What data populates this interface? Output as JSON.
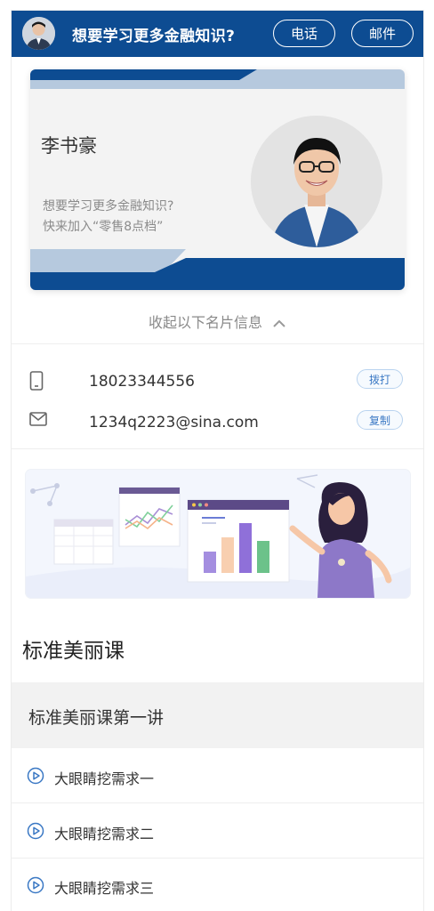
{
  "header": {
    "title": "想要学习更多金融知识?",
    "phone_label": "电话",
    "mail_label": "邮件"
  },
  "card": {
    "name": "李书豪",
    "line1": "想要学习更多金融知识?",
    "line2": "快来加入“零售8点档”"
  },
  "collapse": {
    "label": "收起以下名片信息"
  },
  "contact": {
    "phone": "18023344556",
    "phone_action": "拨打",
    "email": "1234q2223@sina.com",
    "email_action": "复制"
  },
  "course": {
    "title": "标准美丽课",
    "lesson_title": "标准美丽课第一讲",
    "items": [
      "大眼睛挖需求一",
      "大眼睛挖需求二",
      "大眼睛挖需求三"
    ]
  },
  "colors": {
    "brand_blue": "#0d4c92",
    "light_blue": "#b6c9de",
    "accent_blue": "#3a78c4"
  }
}
